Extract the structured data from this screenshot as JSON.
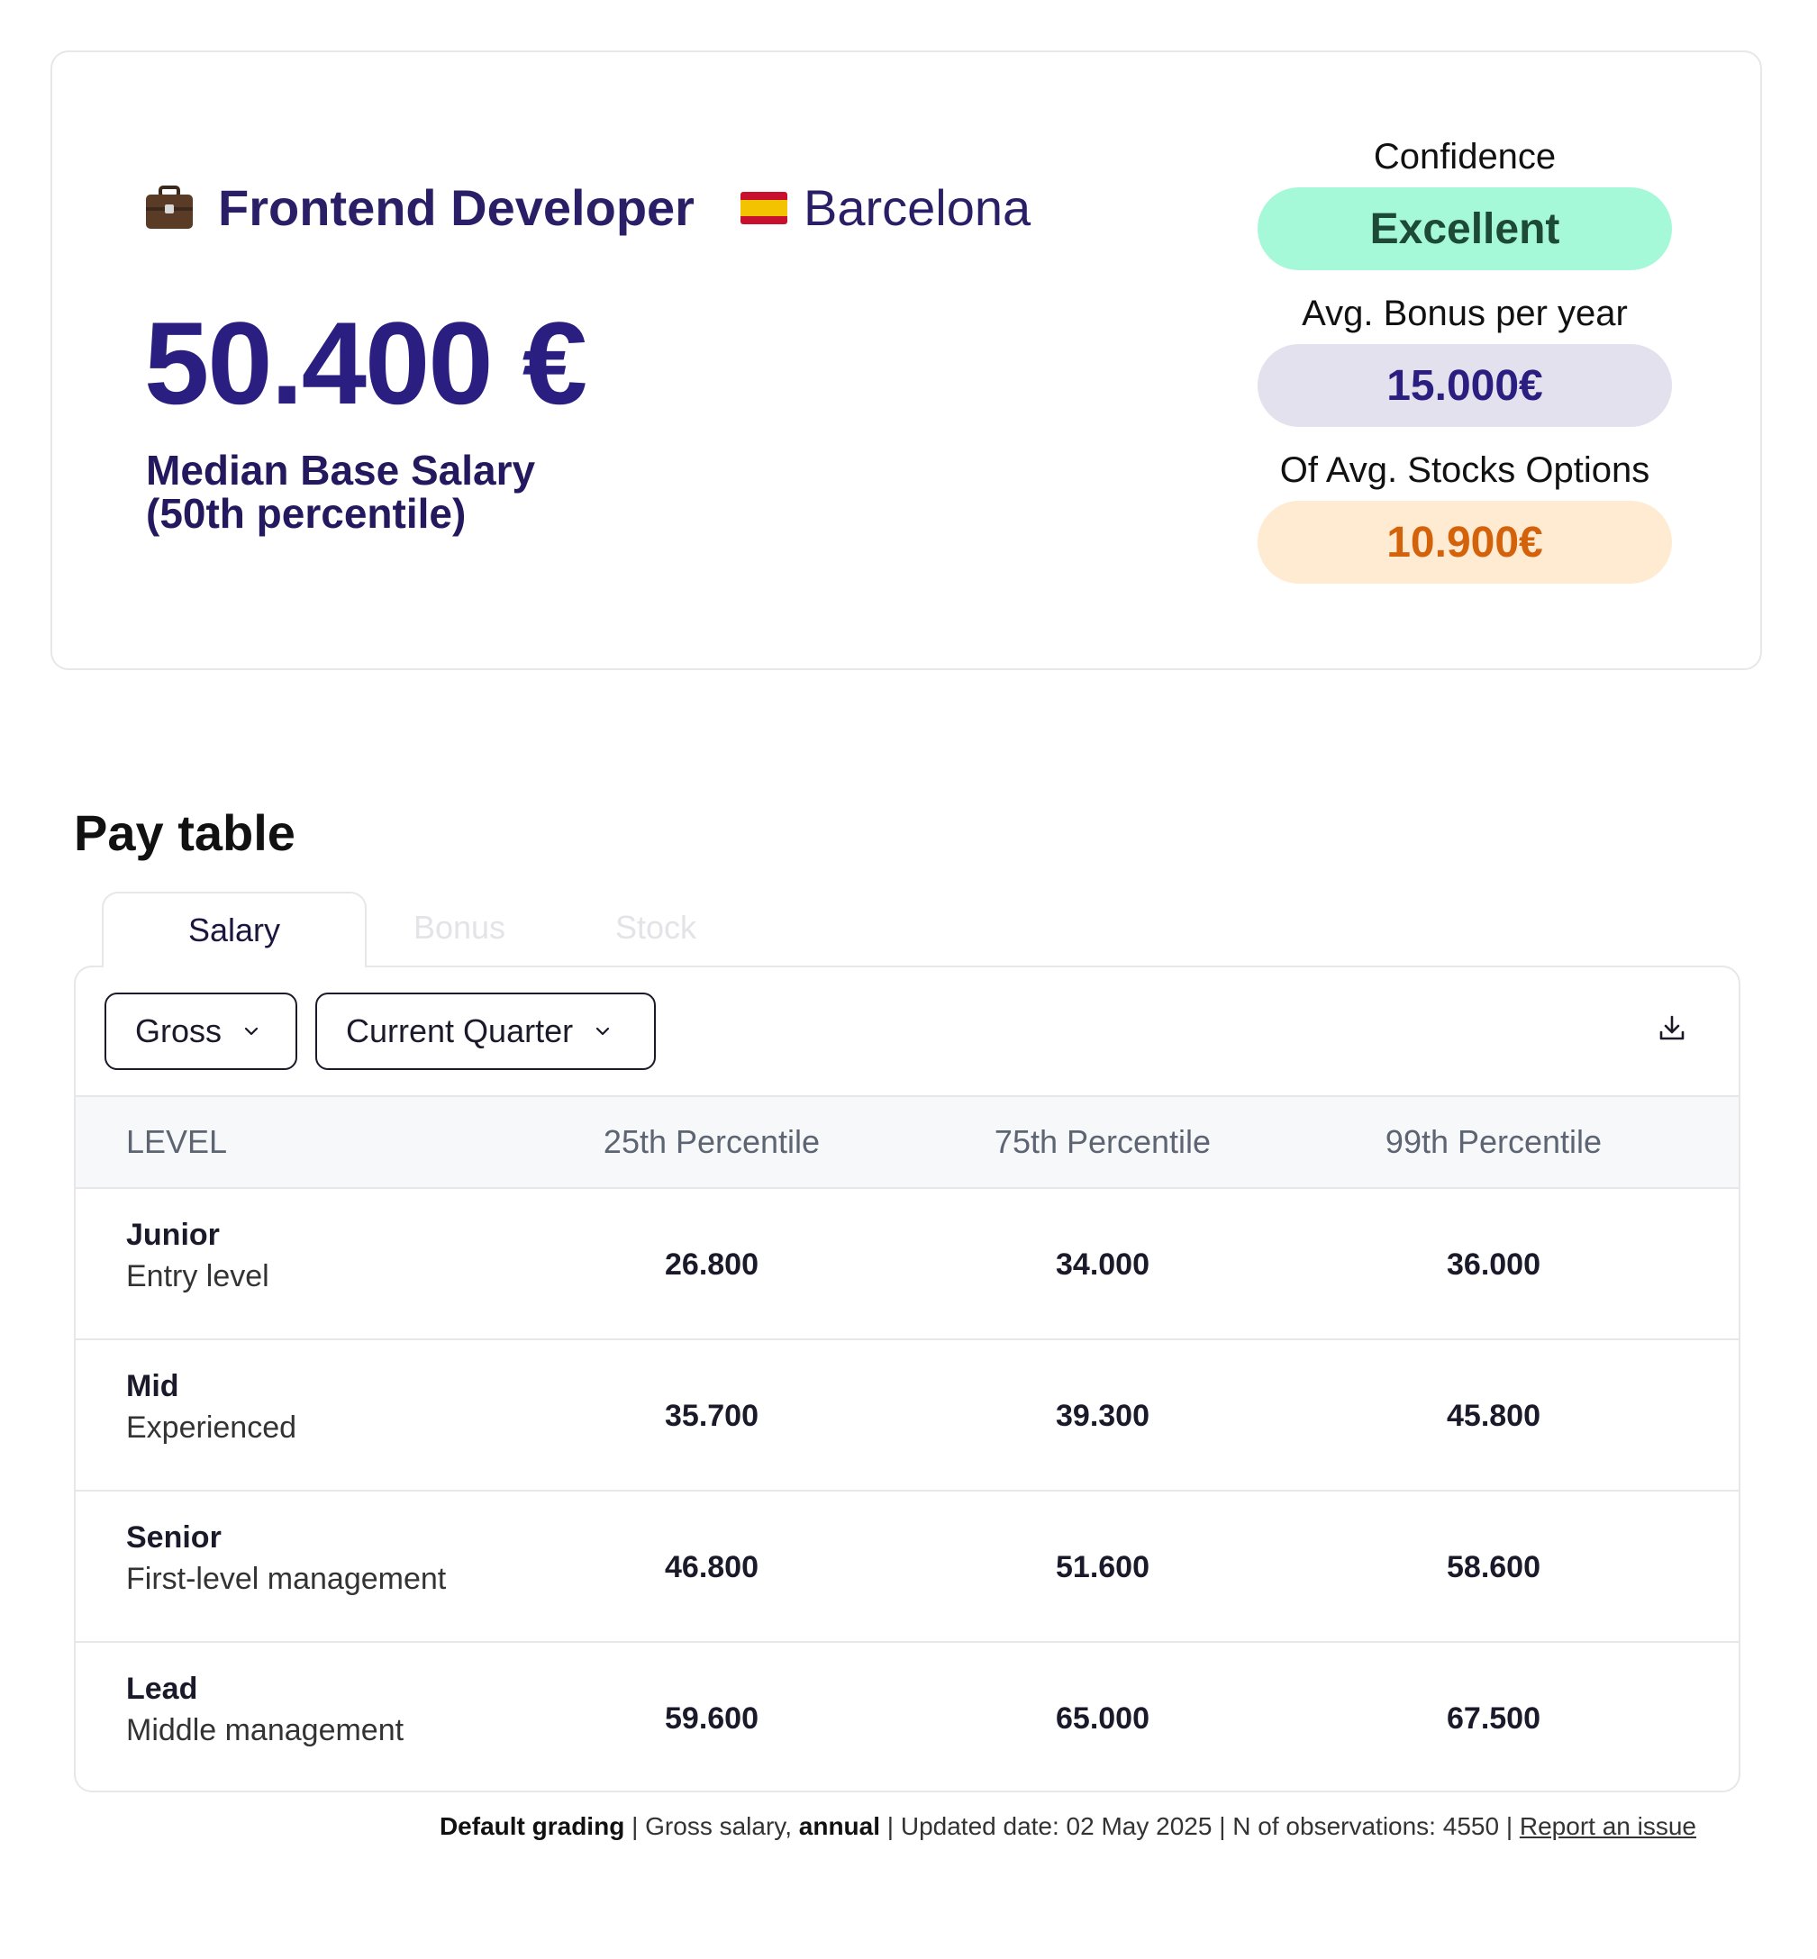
{
  "summary": {
    "job_title": "Frontend Developer",
    "location": "Barcelona",
    "median_amount": "50.400 €",
    "median_label_line1": "Median Base Salary",
    "median_label_line2": "(50th percentile)",
    "confidence_label": "Confidence",
    "confidence_value": "Excellent",
    "bonus_label": "Avg. Bonus per year",
    "bonus_value": "15.000€",
    "stock_label": "Of Avg. Stocks Options",
    "stock_value": "10.900€",
    "icons": {
      "job": "briefcase-icon",
      "location": "spain-flag-icon"
    }
  },
  "pay_table": {
    "title": "Pay table",
    "tabs": [
      {
        "label": "Salary",
        "active": true
      },
      {
        "label": "Bonus",
        "active": false
      },
      {
        "label": "Stock",
        "active": false
      }
    ],
    "filters": {
      "type": "Gross",
      "period": "Current Quarter"
    },
    "columns": [
      "LEVEL",
      "25th Percentile",
      "75th Percentile",
      "99th Percentile"
    ],
    "rows": [
      {
        "level": "Junior",
        "description": "Entry level",
        "p25": "26.800",
        "p75": "34.000",
        "p99": "36.000"
      },
      {
        "level": "Mid",
        "description": "Experienced",
        "p25": "35.700",
        "p75": "39.300",
        "p99": "45.800"
      },
      {
        "level": "Senior",
        "description": "First-level management",
        "p25": "46.800",
        "p75": "51.600",
        "p99": "58.600"
      },
      {
        "level": "Lead",
        "description": "Middle management",
        "p25": "59.600",
        "p75": "65.000",
        "p99": "67.500"
      }
    ]
  },
  "footer": {
    "grading": "Default grading",
    "salary_prefix": "Gross salary,",
    "salary_period": "annual",
    "updated": "Updated date: 02 May 2025",
    "observations": "N of observations: 4550",
    "report_link": "Report an issue"
  },
  "colors": {
    "primary": "#2a1f80",
    "confidence_bg": "#a6f9d8",
    "bonus_bg": "#e3e1ed",
    "stock_bg": "#ffebd2",
    "stock_text": "#d4620b"
  }
}
